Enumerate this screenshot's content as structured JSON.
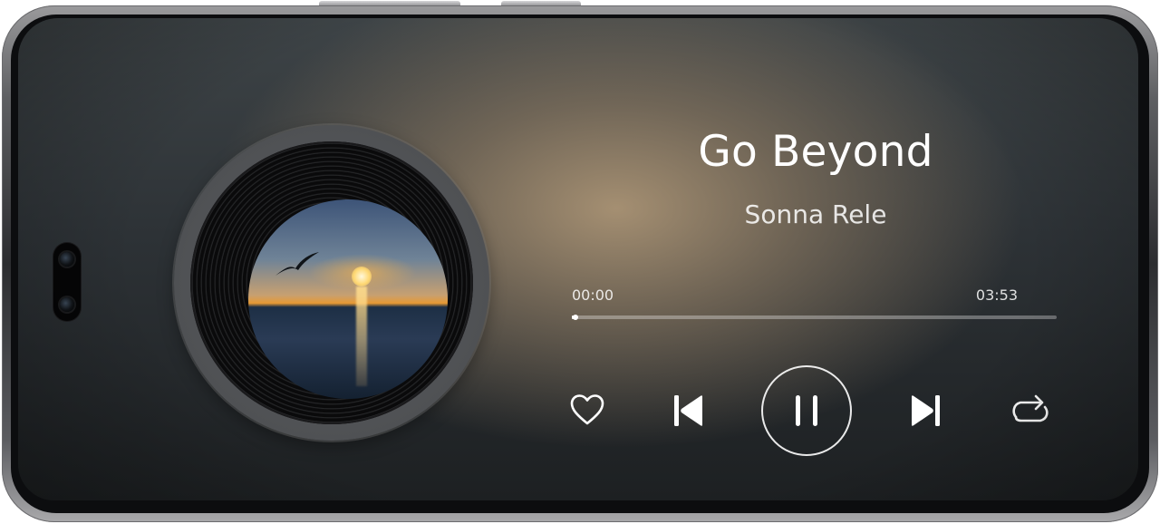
{
  "now_playing": {
    "title": "Go Beyond",
    "artist": "Sonna Rele",
    "time_elapsed": "00:00",
    "time_total": "03:53",
    "progress_fraction": 0.004
  },
  "controls": {
    "favorite_icon": "heart-outline-icon",
    "previous_icon": "skip-previous-icon",
    "playpause_icon": "pause-icon",
    "next_icon": "skip-next-icon",
    "repeat_icon": "repeat-icon"
  },
  "album_art": {
    "icon": "album-art-sunset-image"
  },
  "colors": {
    "text_primary": "#ffffff",
    "track": "rgba(255,255,255,0.32)",
    "background_glow": "#ab9475"
  }
}
